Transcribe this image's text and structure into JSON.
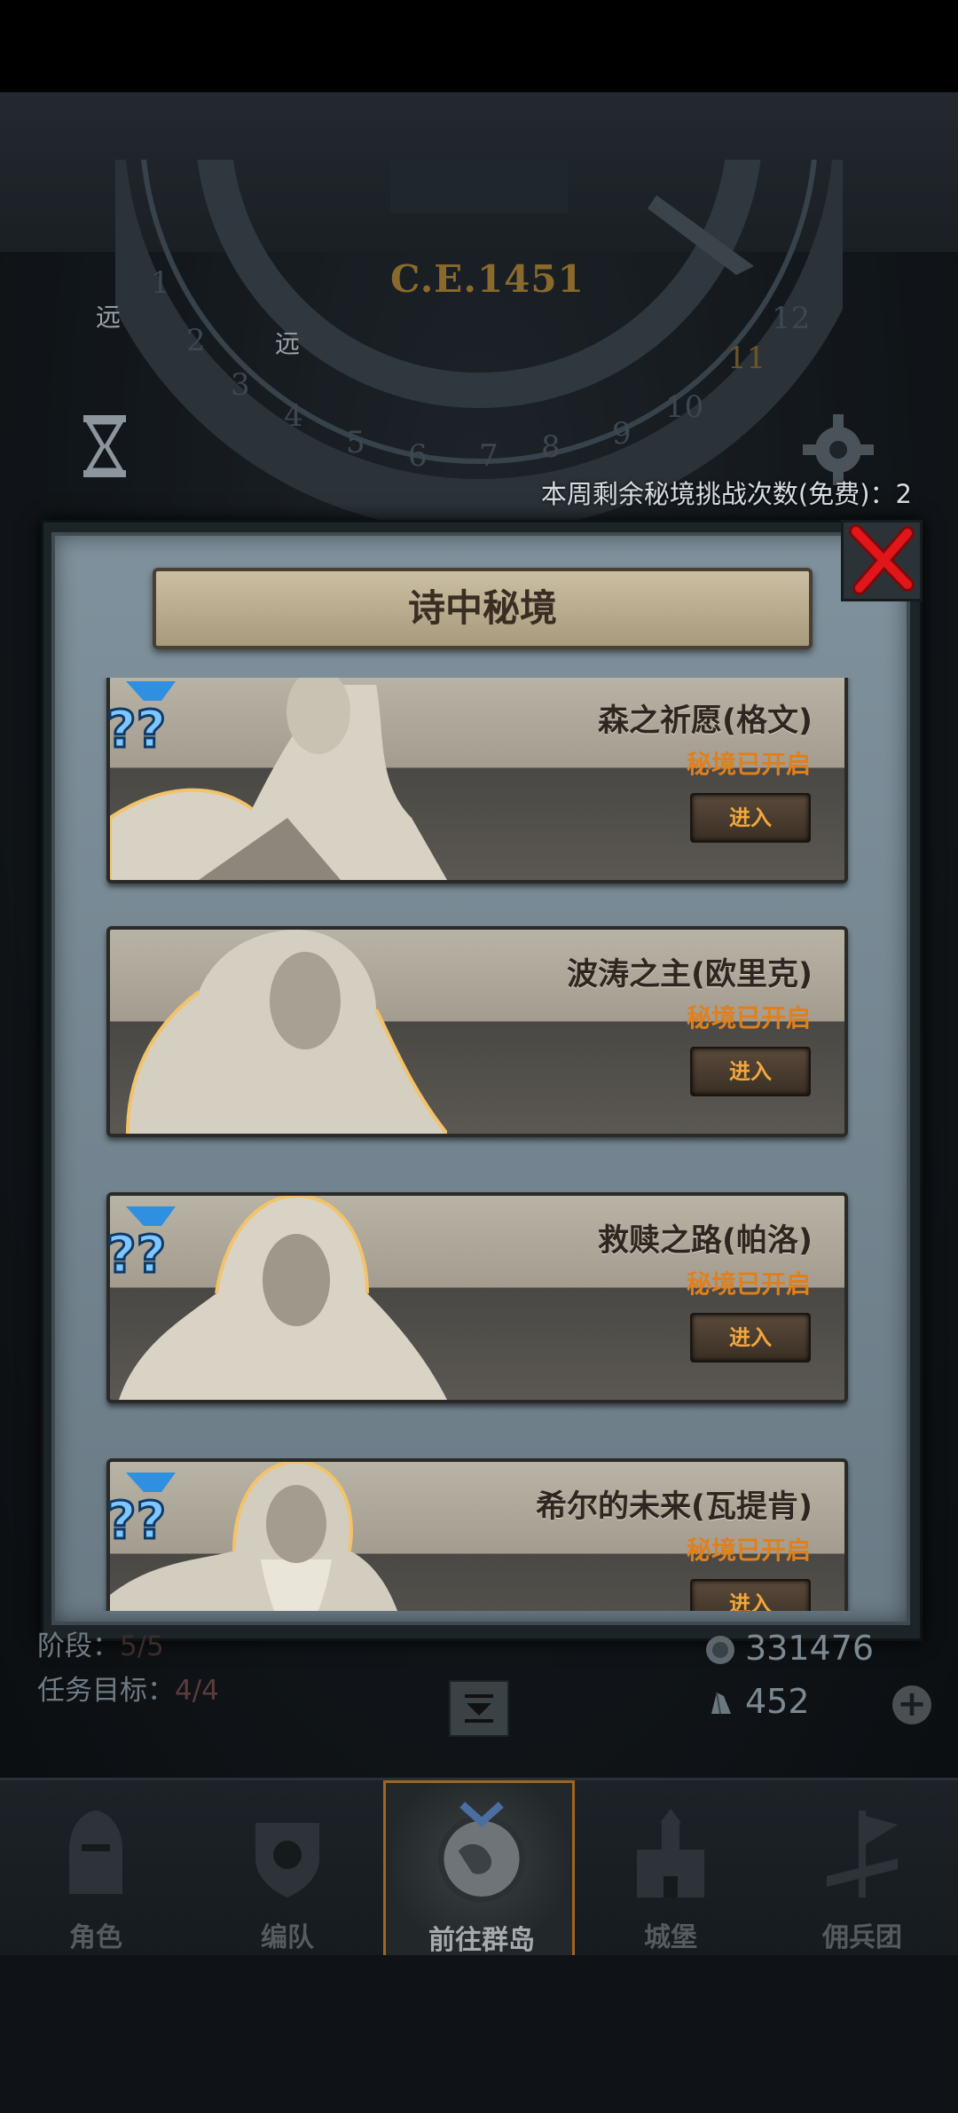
{
  "dial": {
    "era_label": "C.E.1451",
    "sign_left_1": "远",
    "sign_left_2": "远"
  },
  "remaining_challenges": "本周剩余秘境挑战次数(免费)：2",
  "modal": {
    "title": "诗中秘境",
    "entries": [
      {
        "name": "森之祈愿(格文)",
        "status": "秘境已开启",
        "enter_label": "进入",
        "has_question_mark": true
      },
      {
        "name": "波涛之主(欧里克)",
        "status": "秘境已开启",
        "enter_label": "进入",
        "has_question_mark": false
      },
      {
        "name": "救赎之路(帕洛)",
        "status": "秘境已开启",
        "enter_label": "进入",
        "has_question_mark": true
      },
      {
        "name": "希尔的未来(瓦提肯)",
        "status": "秘境已开启",
        "enter_label": "进入",
        "has_question_mark": true
      }
    ]
  },
  "info": {
    "stage_label": "阶段：",
    "stage_value": "5/5",
    "target_label": "任务目标：",
    "target_value": "4/4",
    "coins": "331476",
    "gems": "452"
  },
  "nav": {
    "items": [
      {
        "label": "角色",
        "icon": "knight-helmet-icon"
      },
      {
        "label": "编队",
        "icon": "formation-shield-icon"
      },
      {
        "label": "前往群岛",
        "icon": "globe-compass-icon",
        "active": true
      },
      {
        "label": "城堡",
        "icon": "castle-icon"
      },
      {
        "label": "佣兵团",
        "icon": "mercenary-banner-icon"
      }
    ]
  }
}
